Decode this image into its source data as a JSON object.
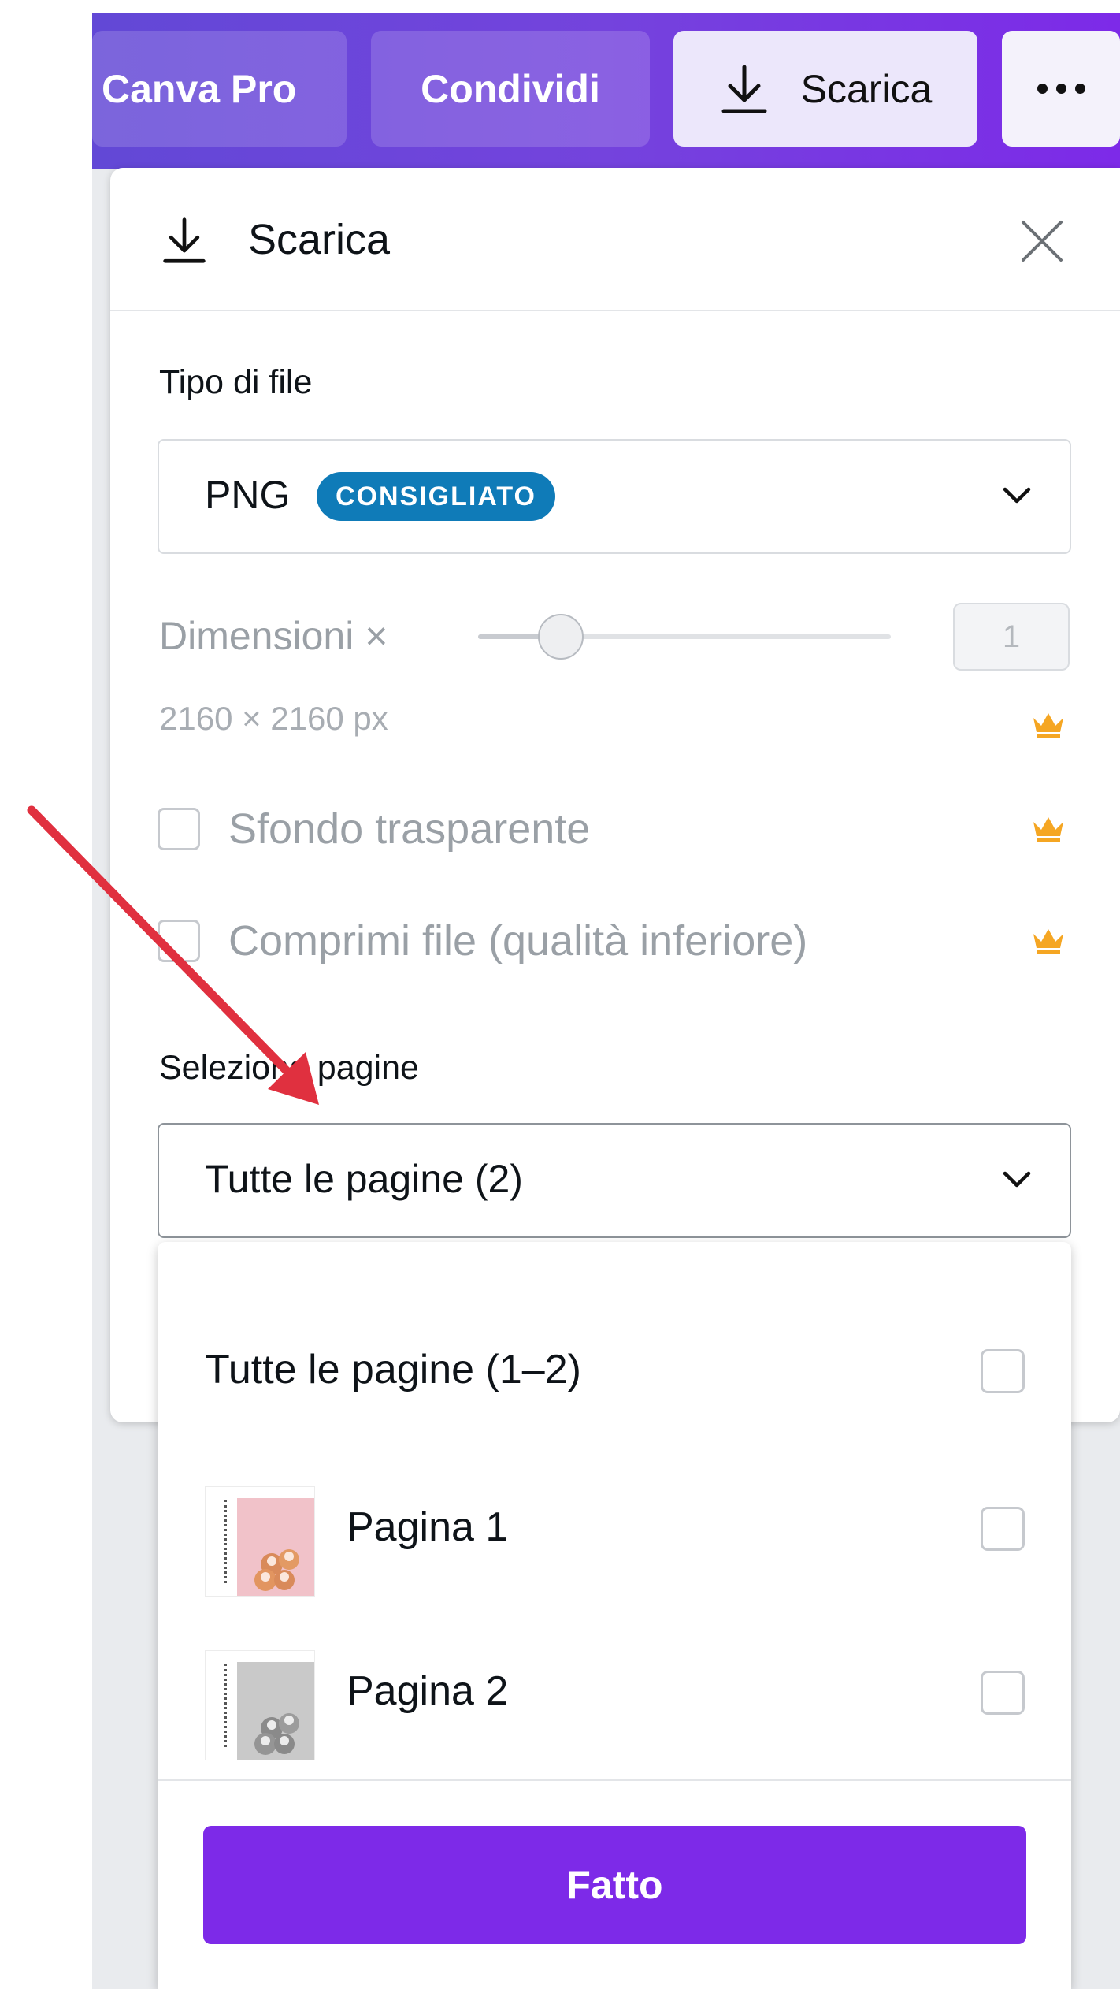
{
  "topbar": {
    "pro_label": "Canva Pro",
    "share_label": "Condividi",
    "download_label": "Scarica",
    "more_icon": "more-dots-icon"
  },
  "panel": {
    "title": "Scarica",
    "file_type": {
      "label": "Tipo di file",
      "value": "PNG",
      "badge": "CONSIGLIATO"
    },
    "size": {
      "label": "Dimensioni ×",
      "slider_fraction": 0.2,
      "scale_value": "1",
      "pixels": "2160 × 2160 px"
    },
    "options": {
      "transparent": "Sfondo trasparente",
      "compress": "Comprimi file (qualità inferiore)"
    },
    "pages": {
      "label": "Seleziona pagine",
      "selected": "Tutte le pagine (2)"
    }
  },
  "menu": {
    "all_pages": "Tutte le pagine (1–2)",
    "items": [
      {
        "label": "Pagina 1"
      },
      {
        "label": "Pagina 2"
      }
    ],
    "done_label": "Fatto"
  },
  "colors": {
    "accent": "#7d2ae8",
    "badge": "#0f7bb8",
    "crown": "#f5a623",
    "annotation_arrow": "#e0303f"
  }
}
